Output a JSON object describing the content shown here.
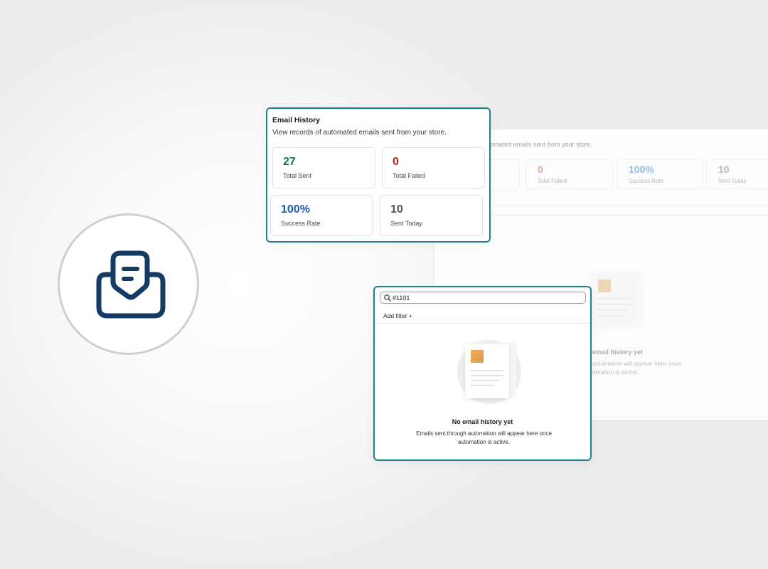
{
  "icon": {
    "name": "email-inbox-icon",
    "color": "#143b64"
  },
  "stats_card": {
    "title": "Email History",
    "description": "View records of automated emails sent from your store.",
    "stats": [
      {
        "value": "27",
        "label": "Total Sent",
        "color": "#11784f"
      },
      {
        "value": "0",
        "label": "Total Failed",
        "color": "#b8281a"
      },
      {
        "value": "100%",
        "label": "Success Rate",
        "color": "#1d5aa8"
      },
      {
        "value": "10",
        "label": "Sent Today",
        "color": "#555555"
      }
    ]
  },
  "search_card": {
    "search_value": "#1101",
    "search_icon": "search-icon",
    "add_filter_label": "Add filter +",
    "empty_title": "No email history yet",
    "empty_description": "Emails sent through automation will appear here once automation is active."
  },
  "background_panel": {
    "description": "omated emails sent from your store.",
    "stats": [
      {
        "value": "0",
        "label": "Total Failed",
        "color": "#e3a597"
      },
      {
        "value": "100%",
        "label": "Success Rate",
        "color": "#8fb3de"
      },
      {
        "value": "10",
        "label": "Sent Today",
        "color": "#b5b5b5"
      }
    ],
    "empty_title": "o email history yet",
    "empty_description": "gh automation will appear here once automation is active."
  },
  "accent_color": "#1f7f8c"
}
